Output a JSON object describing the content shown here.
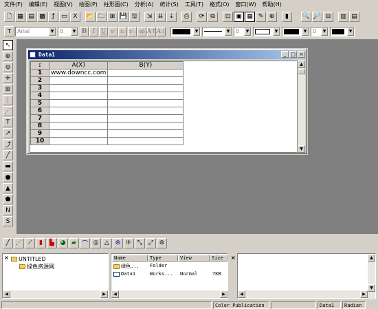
{
  "menu": [
    "文件(F)",
    "编辑(E)",
    "视图(V)",
    "绘图(P)",
    "柱形图(C)",
    "分析(A)",
    "统计(S)",
    "工具(T)",
    "格式(O)",
    "窗口(W)",
    "帮助(H)"
  ],
  "format_toolbar": {
    "font": "Arial",
    "font_size": "0",
    "bold": "B",
    "italic": "I",
    "underline": "U",
    "sup": "x²",
    "sub": "x₂",
    "greek": "αβ",
    "line_size": "0",
    "fill_size": "0"
  },
  "worksheet": {
    "title": "Data1",
    "columns": [
      "A(X)",
      "B(Y)"
    ],
    "rows": [
      "1",
      "2",
      "3",
      "4",
      "5",
      "6",
      "7",
      "8",
      "9",
      "10"
    ],
    "a1": "www.downcc.com",
    "minimize": "_",
    "maximize": "□",
    "close": "×"
  },
  "project_tree": {
    "root": "UNTITLED",
    "folder": "绿色资源网"
  },
  "file_list": {
    "headers": [
      "Name",
      "Type",
      "View",
      "Size"
    ],
    "rows": [
      {
        "name": "绿色...",
        "type": "Folder",
        "view": "",
        "size": ""
      },
      {
        "name": "Data1",
        "type": "Works...",
        "view": "Normal",
        "size": "7KB"
      }
    ]
  },
  "status": {
    "mode": "Color Publication",
    "active": "Data1",
    "unit": "Radian"
  },
  "colors": {
    "bg": "#d4d0c8",
    "workspace": "#808080",
    "title_start": "#0a246a",
    "title_end": "#a6caf0"
  }
}
